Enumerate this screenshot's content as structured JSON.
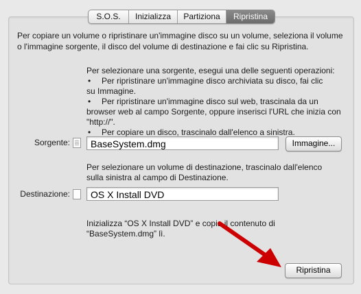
{
  "tabs": [
    {
      "label": "S.O.S.",
      "active": false
    },
    {
      "label": "Inizializza",
      "active": false
    },
    {
      "label": "Partiziona",
      "active": false
    },
    {
      "label": "Ripristina",
      "active": true
    }
  ],
  "intro": {
    "line1": "Per copiare un volume o ripristinare un'immagine disco su un volume, seleziona il volume",
    "line2": "o l'immagine sorgente, il disco del volume di destinazione e fai clic su Ripristina."
  },
  "source_instructions": {
    "heading": "Per selezionare una sorgente, esegui una delle seguenti operazioni:",
    "bullet_symbol": "•",
    "b1_line1": "Per ripristinare un'immagine disco archiviata su disco, fai clic",
    "b1_line2": "su Immagine.",
    "b2_line1": "Per ripristinare un'immagine disco sul web, trascinala da un",
    "b2_line2": "browser web al campo Sorgente, oppure inserisci l'URL che inizia con",
    "b2_line3": "\"http://\".",
    "b3_line1": "Per copiare un disco, trascinalo dall'elenco a sinistra."
  },
  "source": {
    "label": "Sorgente:",
    "value": "BaseSystem.dmg",
    "image_button": "Immagine..."
  },
  "dest_instructions": {
    "line1": "Per selezionare un volume di destinazione, trascinalo dall'elenco",
    "line2": "sulla sinistra al campo di Destinazione."
  },
  "destination": {
    "label": "Destinazione:",
    "value": "OS X Install DVD"
  },
  "summary": {
    "line1": "Inizializza “OS X Install DVD” e copia il contenuto di",
    "line2": "“BaseSystem.dmg” lì."
  },
  "restore_button": "Ripristina",
  "colors": {
    "arrow": "#cc0000",
    "active_tab": "#7a7a7a"
  },
  "icons": {
    "source": "document-icon",
    "destination": "blank-document-icon",
    "annotation": "red-arrow-icon"
  }
}
